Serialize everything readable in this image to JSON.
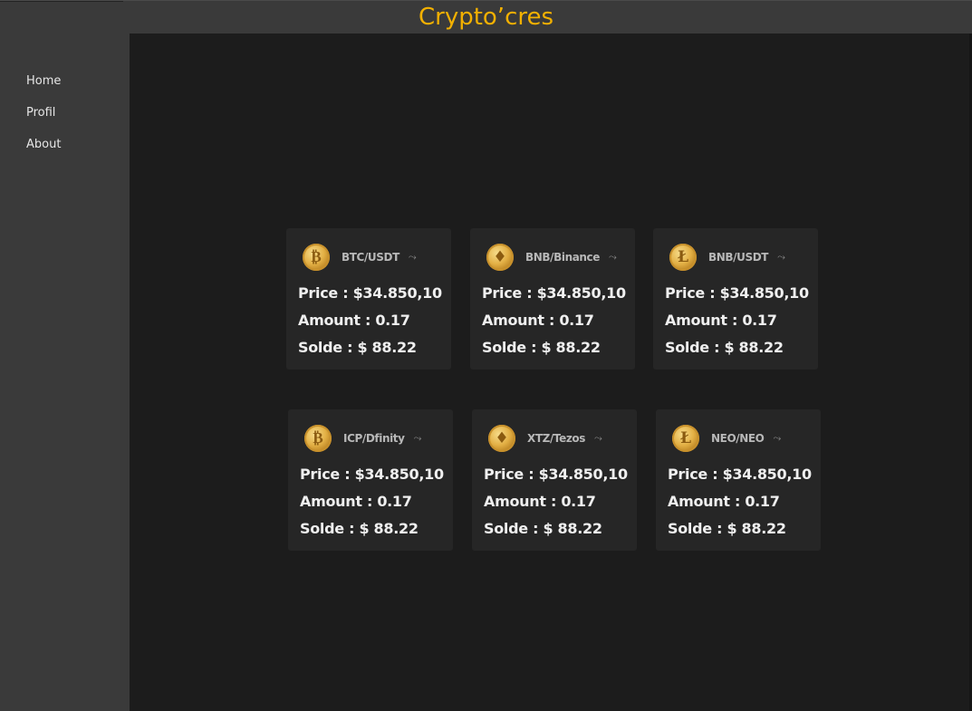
{
  "app": {
    "title": "Crypto’cres"
  },
  "sidebar": {
    "items": [
      {
        "label": "Home"
      },
      {
        "label": "Profil"
      },
      {
        "label": "About"
      }
    ]
  },
  "cards": [
    {
      "pair": "BTC/USDT",
      "coin_icon": "bitcoin-coin-icon",
      "glyph": "₿",
      "price": "Price : $34.850,10",
      "amount": "Amount : 0.17",
      "solde": "Solde : $ 88.22"
    },
    {
      "pair": "BNB/Binance",
      "coin_icon": "ethereum-coin-icon",
      "glyph": "♦",
      "price": "Price : $34.850,10",
      "amount": "Amount : 0.17",
      "solde": "Solde : $ 88.22"
    },
    {
      "pair": "BNB/USDT",
      "coin_icon": "litecoin-coin-icon",
      "glyph": "Ł",
      "price": "Price : $34.850,10",
      "amount": "Amount : 0.17",
      "solde": "Solde : $ 88.22"
    },
    {
      "pair": "ICP/Dfinity",
      "coin_icon": "bitcoin-coin-icon",
      "glyph": "₿",
      "price": "Price : $34.850,10",
      "amount": "Amount : 0.17",
      "solde": "Solde : $ 88.22"
    },
    {
      "pair": "XTZ/Tezos",
      "coin_icon": "ethereum-coin-icon",
      "glyph": "♦",
      "price": "Price : $34.850,10",
      "amount": "Amount : 0.17",
      "solde": "Solde : $ 88.22"
    },
    {
      "pair": "NEO/NEO",
      "coin_icon": "litecoin-coin-icon",
      "glyph": "Ł",
      "price": "Price : $34.850,10",
      "amount": "Amount : 0.17",
      "solde": "Solde : $ 88.22"
    }
  ],
  "icons": {
    "trend": "trend-up-icon"
  },
  "colors": {
    "accent": "#f2b000",
    "background": "#1c1c1c",
    "sidebar": "#3a3a3a",
    "card": "#262626"
  }
}
